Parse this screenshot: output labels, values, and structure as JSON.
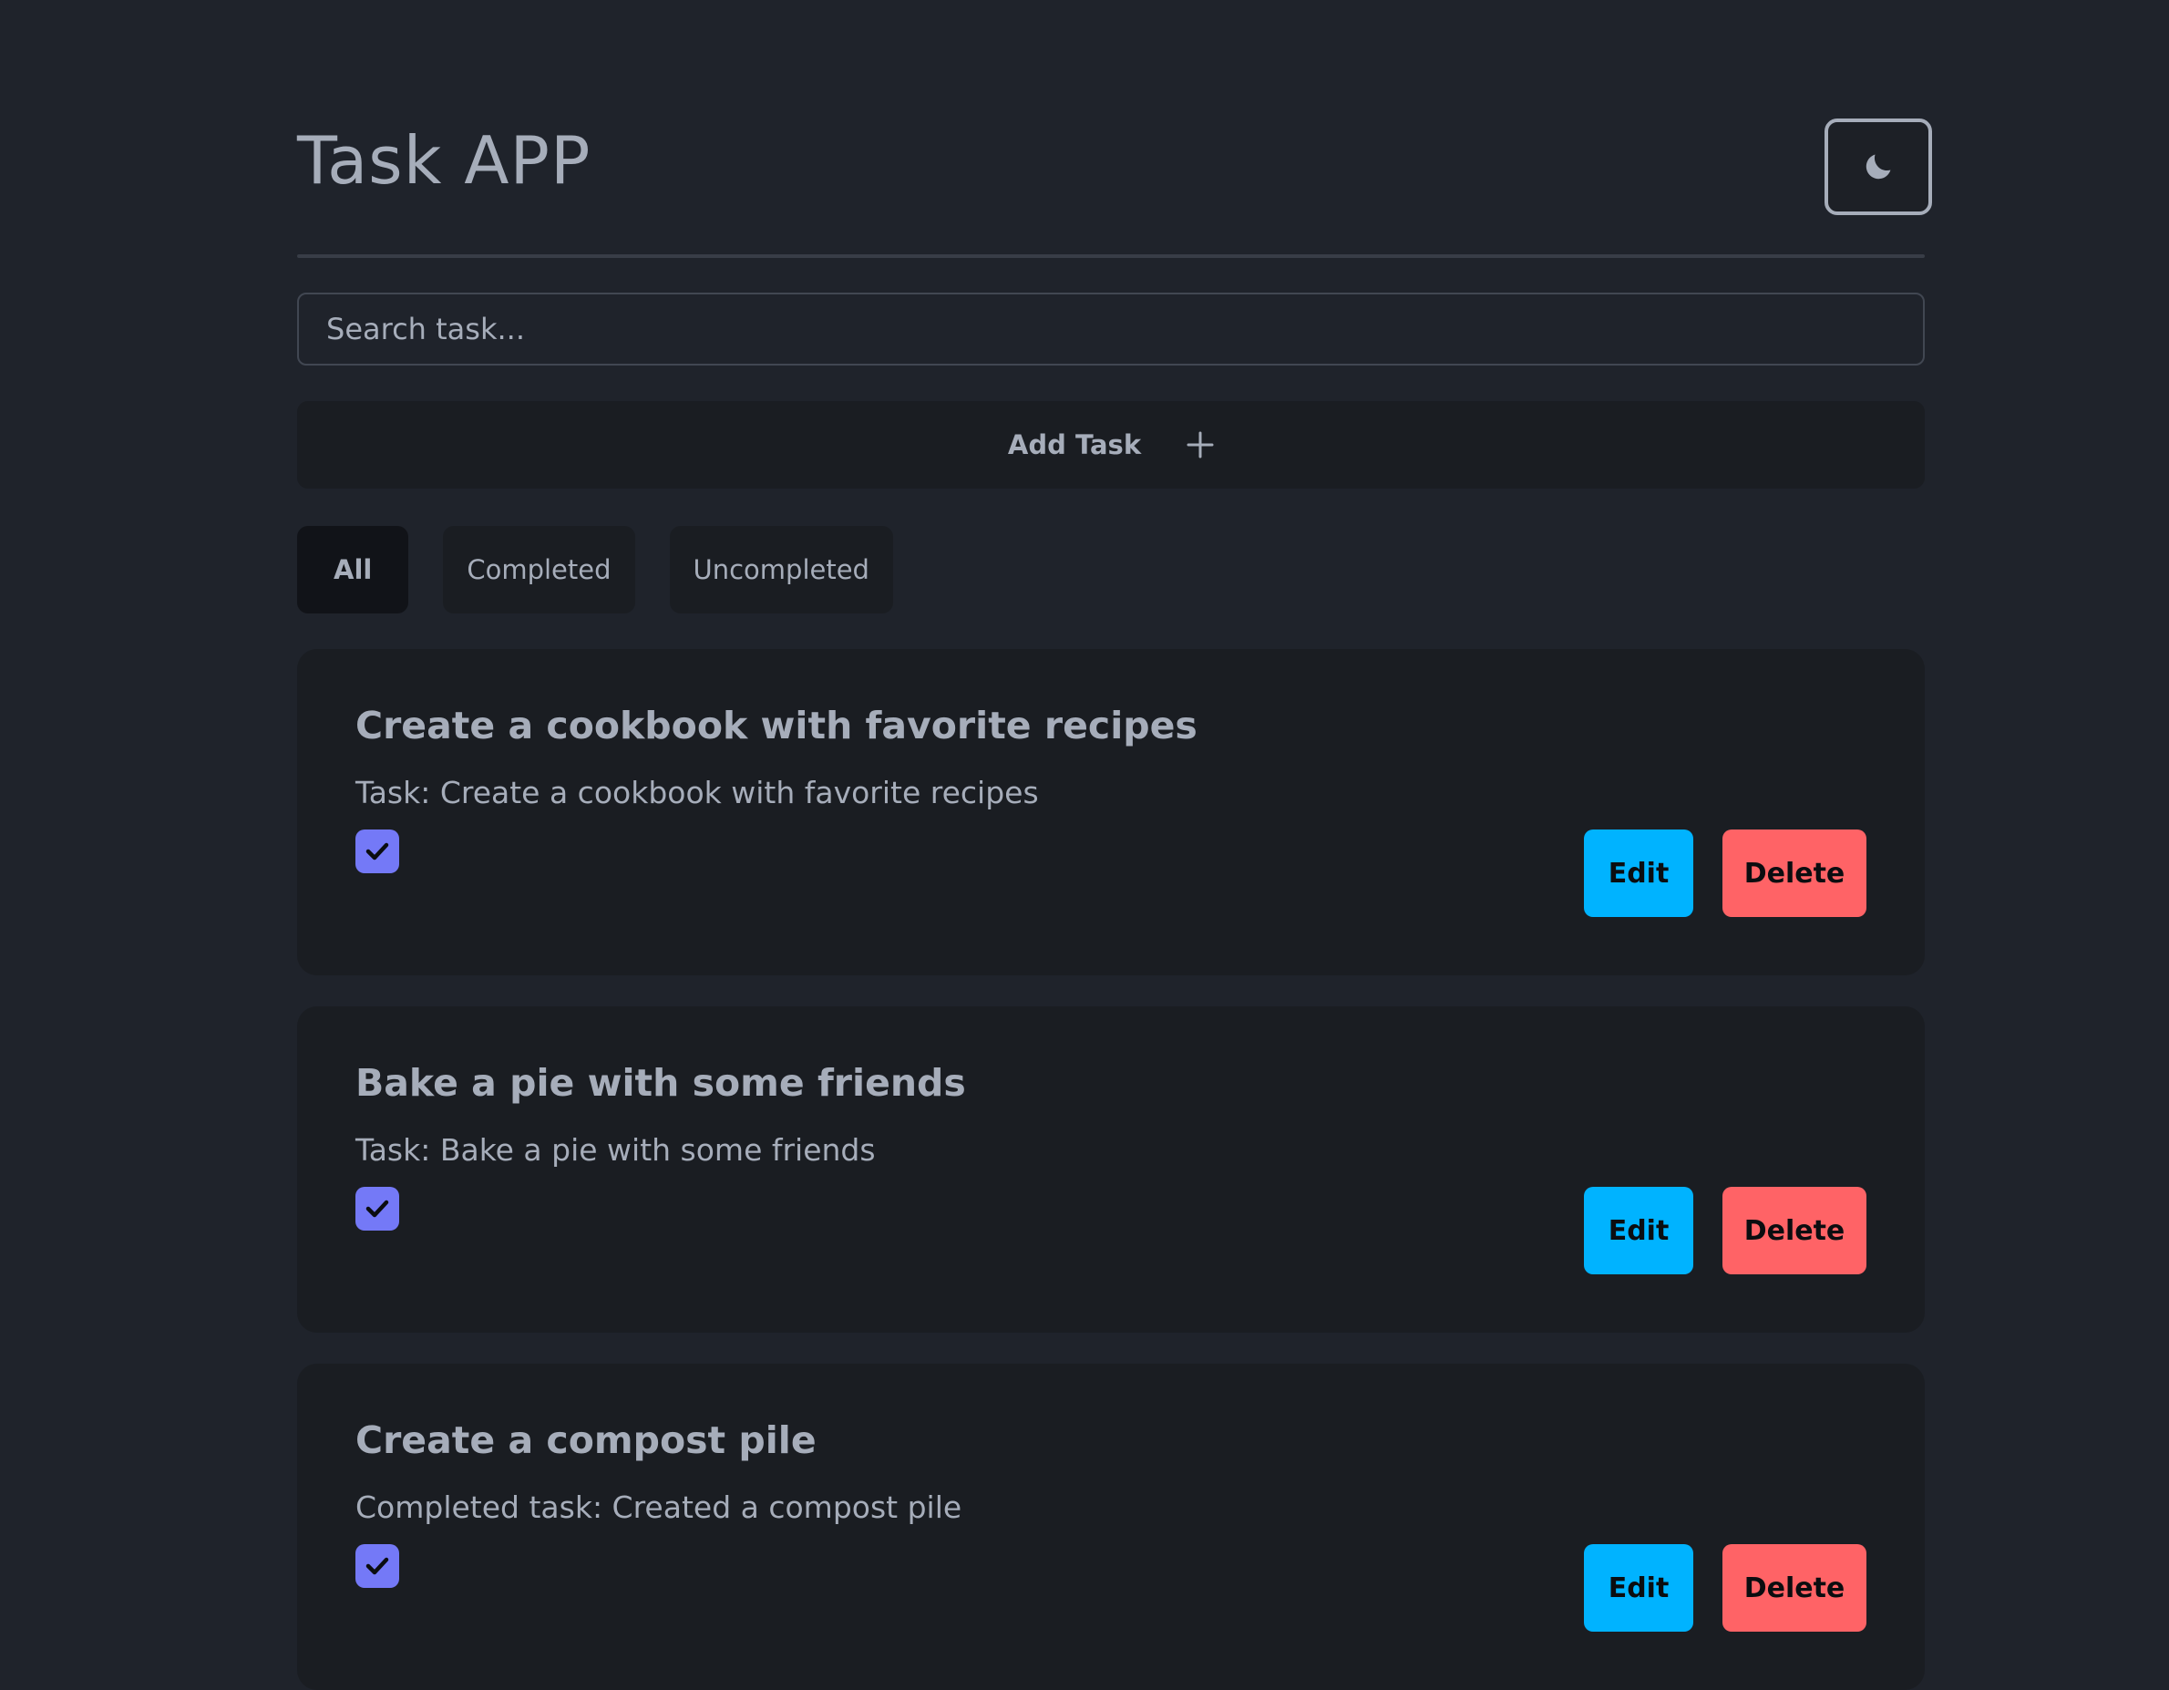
{
  "app": {
    "title": "Task APP",
    "theme_toggle_icon": "moon-icon"
  },
  "search": {
    "placeholder": "Search task..."
  },
  "add_task": {
    "label": "Add Task",
    "icon": "plus-icon"
  },
  "filters": [
    {
      "label": "All",
      "active": true
    },
    {
      "label": "Completed",
      "active": false
    },
    {
      "label": "Uncompleted",
      "active": false
    }
  ],
  "tasks": [
    {
      "title": "Create a cookbook with favorite recipes",
      "description": "Task: Create a cookbook with favorite recipes",
      "completed": true,
      "edit_label": "Edit",
      "delete_label": "Delete"
    },
    {
      "title": "Bake a pie with some friends",
      "description": "Task: Bake a pie with some friends",
      "completed": true,
      "edit_label": "Edit",
      "delete_label": "Delete"
    },
    {
      "title": "Create a compost pile",
      "description": "Completed task: Created a compost pile",
      "completed": true,
      "edit_label": "Edit",
      "delete_label": "Delete"
    }
  ],
  "colors": {
    "background": "#1f232b",
    "card": "#1a1d22",
    "text": "#a6adba",
    "checkbox": "#7479f7",
    "edit": "#00b3ff",
    "delete": "#ff6366"
  }
}
